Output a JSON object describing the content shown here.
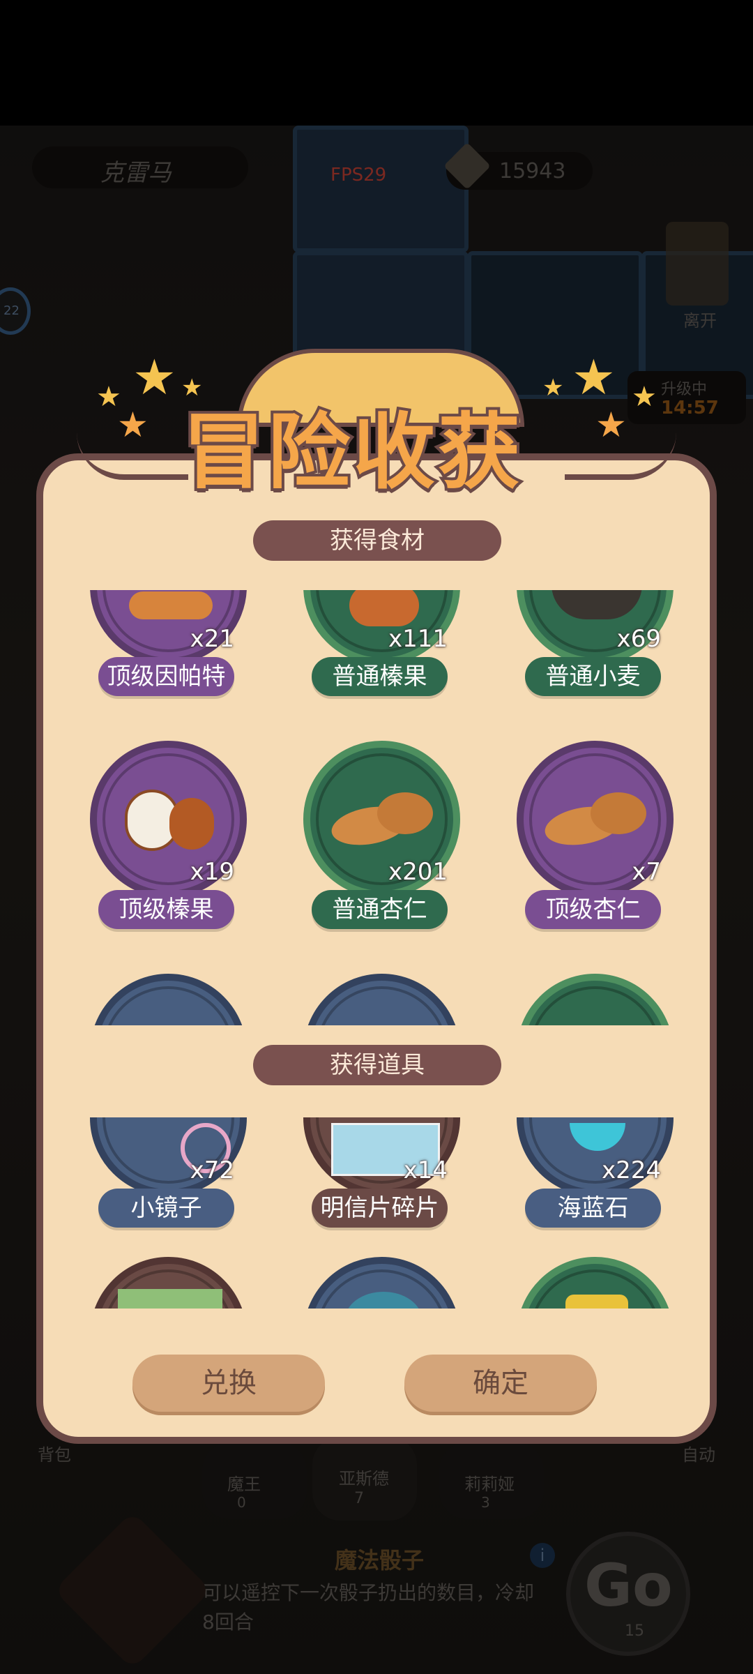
{
  "top_bar": {
    "player_name": "克雷马",
    "fps": "FPS29",
    "currency": "15943"
  },
  "side": {
    "exit_label": "离开",
    "upgrade_label": "升级中",
    "upgrade_timer": "14:57",
    "left_badge": "22"
  },
  "bottom_bg": {
    "bag_label": "背包",
    "auto_label": "自动",
    "characters": [
      {
        "name": "魔王",
        "count": "0"
      },
      {
        "name": "亚斯德",
        "count": "7"
      },
      {
        "name": "莉莉娅",
        "count": "3"
      }
    ],
    "skill_title": "魔法骰子",
    "skill_desc_line1": "可以遥控下一次骰子扔出的数目，冷却",
    "skill_desc_line2": "8回合",
    "go_label": "Go",
    "go_cost": "15"
  },
  "dialog": {
    "title": "冒险收获",
    "section_food": "获得食材",
    "section_items": "获得道具",
    "food_items": [
      {
        "name": "顶级因帕特",
        "count": "x21",
        "color": "purple"
      },
      {
        "name": "普通榛果",
        "count": "x111",
        "color": "green"
      },
      {
        "name": "普通小麦",
        "count": "x69",
        "color": "green"
      },
      {
        "name": "顶级榛果",
        "count": "x19",
        "color": "purple"
      },
      {
        "name": "普通杏仁",
        "count": "x201",
        "color": "green"
      },
      {
        "name": "顶级杏仁",
        "count": "x7",
        "color": "purple"
      }
    ],
    "prop_items": [
      {
        "name": "小镜子",
        "count": "x72",
        "color": "blue"
      },
      {
        "name": "明信片碎片",
        "count": "x14",
        "color": "brown"
      },
      {
        "name": "海蓝石",
        "count": "x224",
        "color": "blue"
      }
    ],
    "exchange_button": "兑换",
    "confirm_button": "确定"
  },
  "colors": {
    "dialog_bg": "#f6dcb6",
    "dialog_border": "#6c4a47",
    "purple": "#7a4e92",
    "green": "#2f6a4e",
    "blue": "#485e80",
    "button": "#d4a57a",
    "title": "#f5a64a"
  }
}
